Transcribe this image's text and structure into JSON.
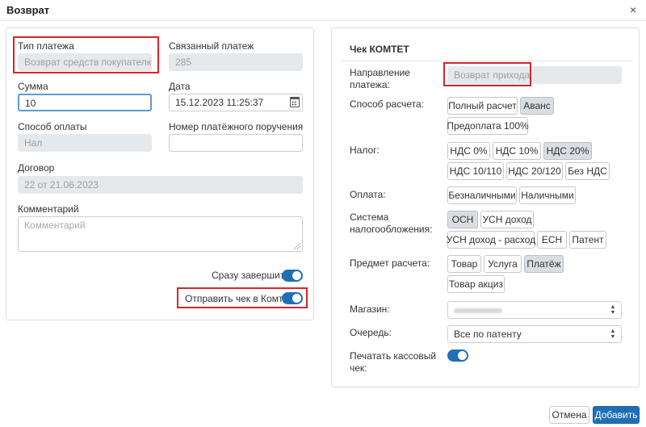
{
  "dialog": {
    "title": "Возврат",
    "close_icon": "×"
  },
  "left": {
    "payment_type": {
      "label": "Тип платежа",
      "value": "Возврат средств покупателю"
    },
    "linked_payment": {
      "label": "Связанный платеж",
      "value": "285"
    },
    "amount": {
      "label": "Сумма",
      "value": "10"
    },
    "date": {
      "label": "Дата",
      "value": "15.12.2023 11:25:37"
    },
    "payment_method": {
      "label": "Способ оплаты",
      "value": "Нал"
    },
    "order_number": {
      "label": "Номер платёжного поручения",
      "value": ""
    },
    "contract": {
      "label": "Договор",
      "value": "22 от 21.06.2023"
    },
    "comment": {
      "label": "Комментарий",
      "placeholder": "Комментарий"
    },
    "finish_now": {
      "label": "Сразу завершить",
      "on": true
    },
    "send_receipt": {
      "label": "Отправить чек в Комтет",
      "on": true
    }
  },
  "right": {
    "header": "Чек КОМТЕТ",
    "direction": {
      "label": "Направление платежа:",
      "value": "Возврат прихода"
    },
    "calc_method": {
      "label": "Способ расчета:",
      "options": [
        "Полный расчет",
        "Аванс",
        "Предоплата 100%"
      ],
      "selected": "Аванс"
    },
    "tax": {
      "label": "Налог:",
      "options": [
        "НДС 0%",
        "НДС 10%",
        "НДС 20%",
        "НДС 10/110",
        "НДС 20/120",
        "Без НДС"
      ],
      "selected": "НДС 20%"
    },
    "payment": {
      "label": "Оплата:",
      "options": [
        "Безналичными",
        "Наличными"
      ]
    },
    "tax_system": {
      "label": "Система налогообложения:",
      "options": [
        "ОСН",
        "УСН доход",
        "УСН доход - расход",
        "ЕСН",
        "Патент"
      ],
      "selected": "ОСН"
    },
    "subject": {
      "label": "Предмет расчета:",
      "options": [
        "Товар",
        "Услуга",
        "Платёж",
        "Товар акциз"
      ],
      "selected": "Платёж"
    },
    "shop": {
      "label": "Магазин:",
      "value": ""
    },
    "queue": {
      "label": "Очередь:",
      "value": "Все по патенту"
    },
    "print_receipt": {
      "label": "Печатать кассовый чек:",
      "on": true
    }
  },
  "footer": {
    "cancel": "Отмена",
    "add": "Добавить"
  },
  "colors": {
    "accent": "#1f6fb5",
    "highlight": "#d9232d"
  }
}
